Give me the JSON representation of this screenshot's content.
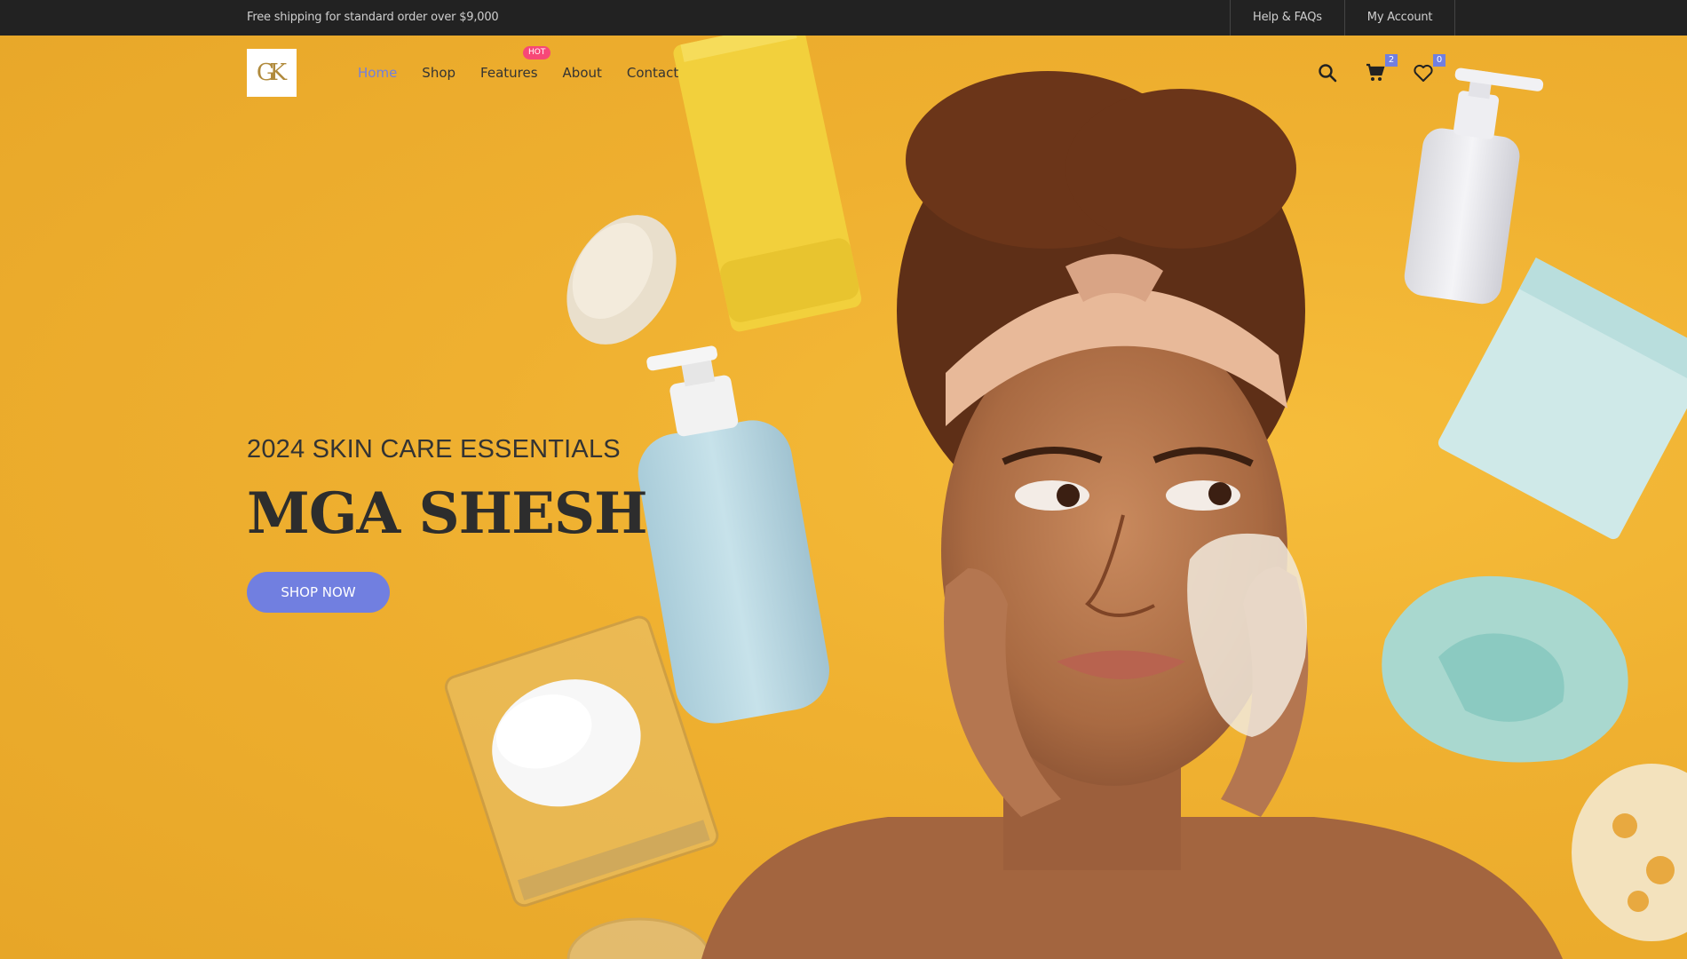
{
  "topbar": {
    "shipping_text": "Free shipping for standard order over $9,000",
    "links": [
      "Help & FAQs",
      "My Account"
    ]
  },
  "header": {
    "logo_text": "GK",
    "nav": [
      {
        "label": "Home",
        "active": true
      },
      {
        "label": "Shop"
      },
      {
        "label": "Features",
        "badge": "HOT"
      },
      {
        "label": "About"
      },
      {
        "label": "Contact"
      }
    ],
    "icons": {
      "search": "search-icon",
      "cart": "cart-icon",
      "cart_count": "2",
      "wishlist": "heart-icon",
      "wishlist_count": "0"
    }
  },
  "hero": {
    "subtitle": "2024 SKIN CARE ESSENTIALS",
    "title": "MGA SHESH",
    "button_label": "SHOP NOW"
  },
  "colors": {
    "accent": "#717fe0",
    "hot_badge": "#f74877",
    "topbar_bg": "#222222",
    "hero_bg": "#f0b233"
  }
}
